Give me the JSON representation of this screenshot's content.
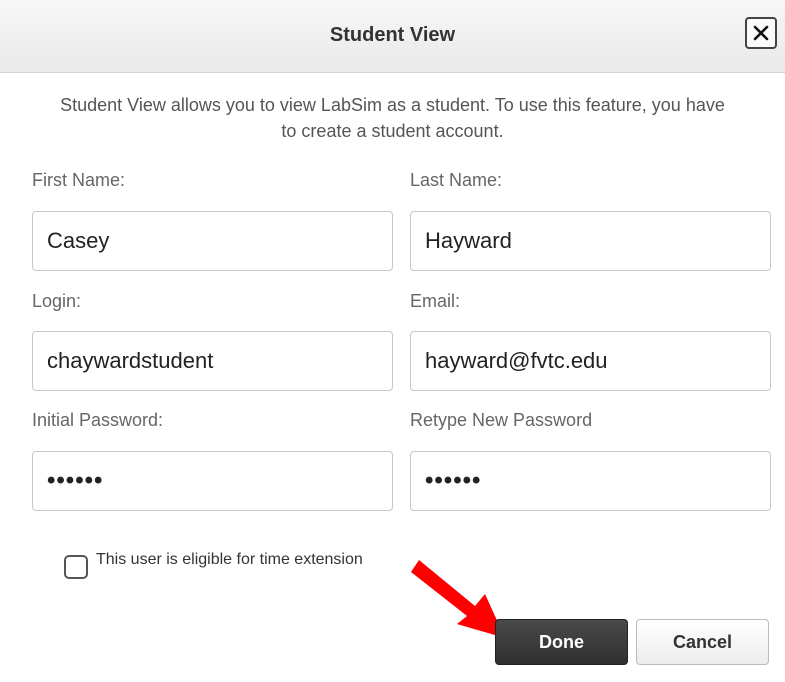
{
  "dialog": {
    "title": "Student View",
    "close_icon": "close-icon",
    "intro": "Student View allows you to view LabSim as a student. To use this feature, you have to create a student account."
  },
  "form": {
    "first_name": {
      "label": "First Name:",
      "value": "Casey"
    },
    "last_name": {
      "label": "Last Name:",
      "value": "Hayward"
    },
    "login": {
      "label": "Login:",
      "value": "chaywardstudent"
    },
    "email": {
      "label": "Email:",
      "value": "hayward@fvtc.edu"
    },
    "initial_password": {
      "label": "Initial Password:",
      "value": "••••••"
    },
    "retype_password": {
      "label": "Retype New Password",
      "value": "••••••"
    },
    "time_extension": {
      "label": "This user is eligible for time extension",
      "checked": false
    }
  },
  "buttons": {
    "done": "Done",
    "cancel": "Cancel"
  },
  "annotation": {
    "icon": "red-arrow-icon",
    "color": "#ff0000"
  }
}
